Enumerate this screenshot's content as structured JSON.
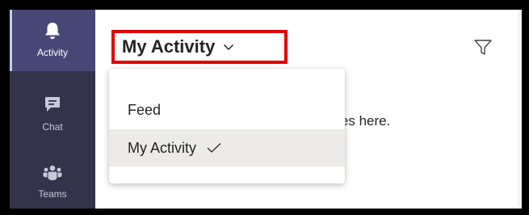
{
  "rail": {
    "items": [
      {
        "label": "Activity",
        "icon": "bell-icon",
        "active": true
      },
      {
        "label": "Chat",
        "icon": "chat-icon",
        "active": false
      },
      {
        "label": "Teams",
        "icon": "teams-icon",
        "active": false
      }
    ]
  },
  "header": {
    "title": "My Activity",
    "chevron_icon": "chevron-down-icon",
    "filter_icon": "filter-icon"
  },
  "main": {
    "empty_message": "ssages here."
  },
  "dropdown": {
    "items": [
      {
        "label": "Feed",
        "selected": false
      },
      {
        "label": "My Activity",
        "selected": true,
        "icon": "checkmark-icon"
      }
    ]
  },
  "colors": {
    "rail_bg": "#33344a",
    "rail_active_bg": "#464775",
    "highlight_border": "#e00000",
    "selected_item_bg": "#edebe9"
  }
}
